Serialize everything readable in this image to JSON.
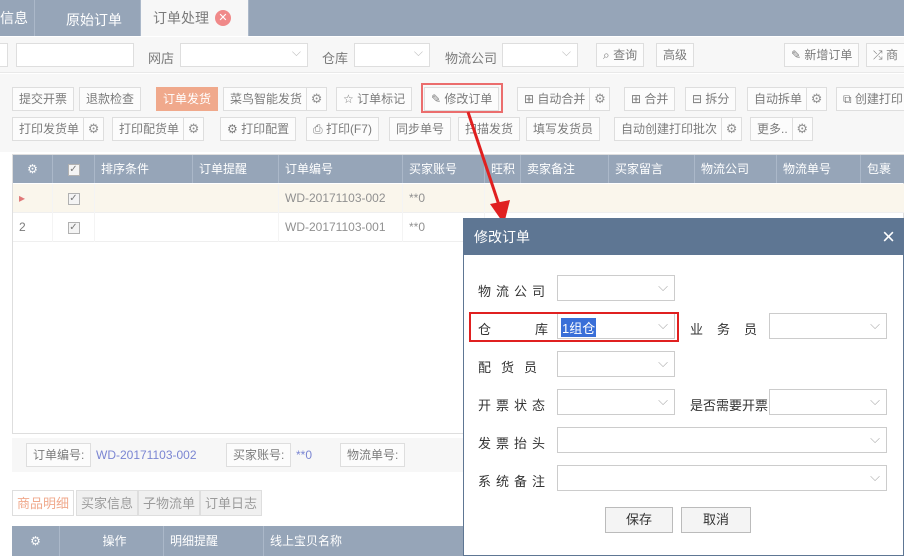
{
  "tabs": [
    "信息",
    "原始订单",
    "订单处理"
  ],
  "search": {
    "shop_label": "网店",
    "warehouse_label": "仓库",
    "logistics_label": "物流公司",
    "query": "查询",
    "advanced": "高级",
    "new_order": "新增订单",
    "more": "商"
  },
  "toolbar": {
    "row1": [
      "提交开票",
      "退款检查",
      "订单发货",
      "菜鸟智能发货",
      "订单标记",
      "修改订单",
      "自动合并",
      "合并",
      "拆分",
      "自动拆单",
      "创建打印"
    ],
    "row2": [
      "打印发货单",
      "打印配货单",
      "打印配置",
      "打印(F7)",
      "同步单号",
      "扫描发货",
      "填写发货员",
      "自动创建打印批次",
      "更多.."
    ]
  },
  "grid": {
    "headers": [
      "排序条件",
      "订单提醒",
      "订单编号",
      "买家账号",
      "旺积",
      "卖家备注",
      "买家留言",
      "物流公司",
      "物流单号",
      "包裹"
    ],
    "rows": [
      {
        "num": "▸",
        "order": "WD-20171103-002",
        "buyer": "**0"
      },
      {
        "num": "2",
        "order": "WD-20171103-001",
        "buyer": "**0"
      }
    ]
  },
  "info": {
    "order_label": "订单编号:",
    "order_value": "WD-20171103-002",
    "buyer_label": "买家账号:",
    "buyer_value": "**0",
    "tracking_label": "物流单号:"
  },
  "subtabs": [
    "商品明细",
    "买家信息",
    "子物流单",
    "订单日志"
  ],
  "subgrid": {
    "headers": [
      "操作",
      "明细提醒",
      "线上宝贝名称"
    ]
  },
  "dialog": {
    "title": "修改订单",
    "logistics": "物流公司",
    "warehouse": "仓库",
    "warehouse_value": "1组仓",
    "salesman": "业务员",
    "picker": "配货员",
    "invoice_status": "开票状态",
    "need_invoice": "是否需要开票",
    "invoice_title": "发票抬头",
    "remark": "系统备注",
    "save": "保存",
    "cancel": "取消"
  },
  "colors": {
    "header": "#5e7693",
    "accent": "#e87b4f",
    "highlight": "#e02020"
  }
}
